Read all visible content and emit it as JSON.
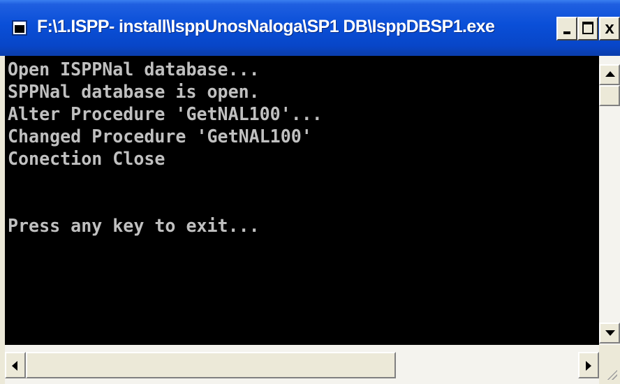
{
  "window": {
    "title": "F:\\1.ISPP- install\\IsppUnosNaloga\\SP1 DB\\IsppDBSP1.exe",
    "icon": "console-window-icon",
    "buttons": {
      "minimize_icon": "minimize-icon",
      "maximize_icon": "maximize-icon",
      "close_label": "x"
    }
  },
  "console": {
    "lines": [
      "Open ISPPNal database...",
      "SPPNal database is open.",
      "Alter Procedure 'GetNAL100'...",
      "Changed Procedure 'GetNAL100'",
      "Conection Close",
      "",
      "",
      "Press any key to exit..."
    ],
    "colors": {
      "background": "#000000",
      "text": "#c0c0c0"
    }
  },
  "scrollbars": {
    "vertical": {
      "up_icon": "arrow-up-icon",
      "down_icon": "arrow-down-icon"
    },
    "horizontal": {
      "left_icon": "arrow-left-icon",
      "right_icon": "arrow-right-icon"
    }
  },
  "colors": {
    "titlebar": "#0a4fd8",
    "title_text": "#ffffff",
    "chrome": "#ece9d8"
  }
}
